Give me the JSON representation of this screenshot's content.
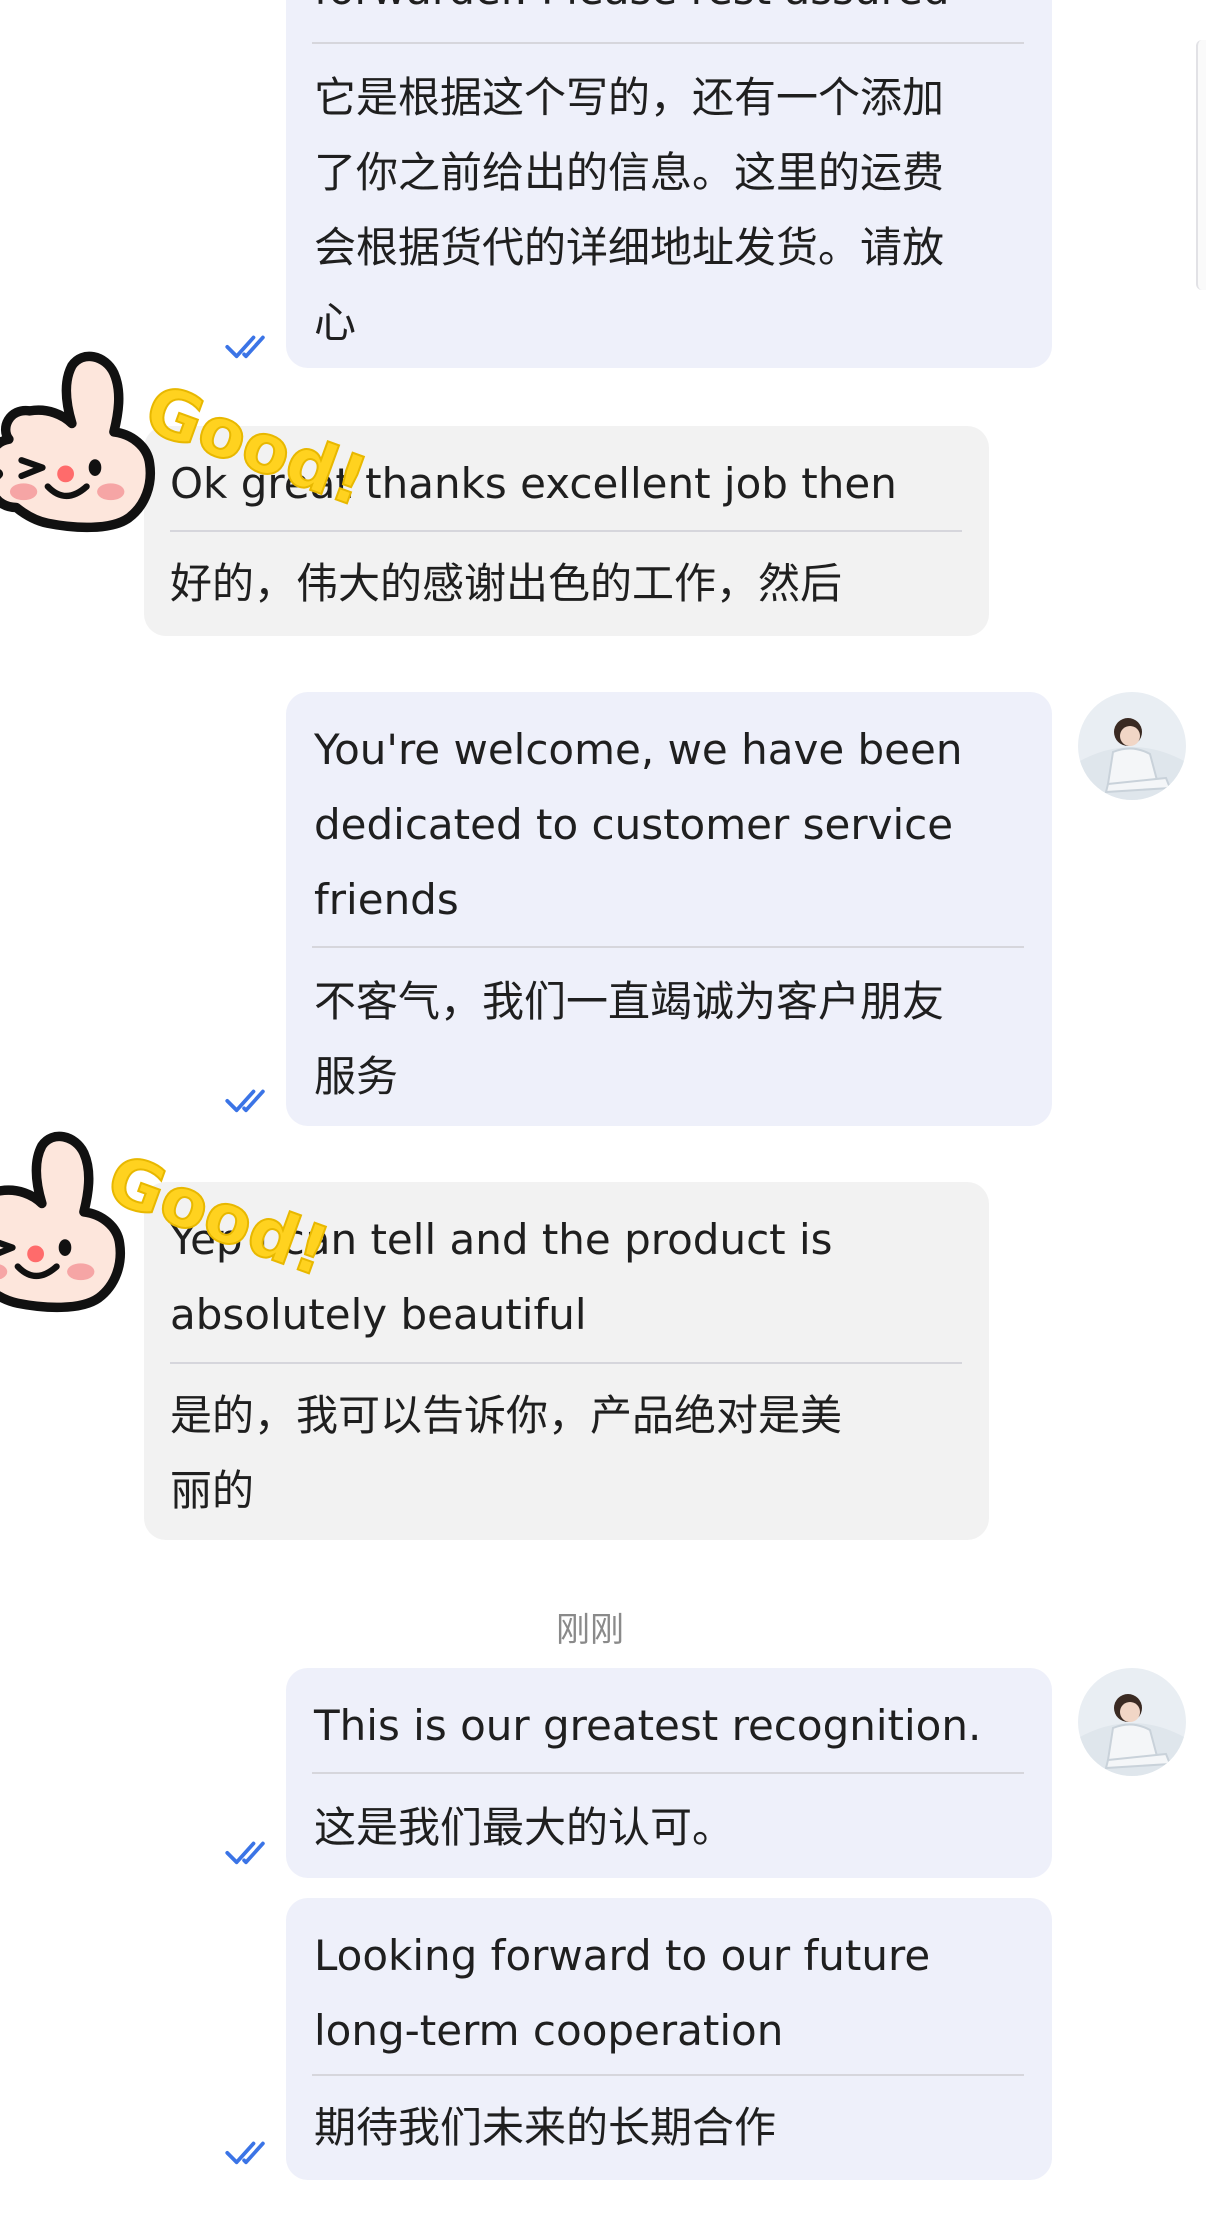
{
  "colors": {
    "outgoing_bubble": "#eef0fa",
    "incoming_bubble": "#f2f2f2",
    "read_check": "#3b74e6",
    "sticker_text": "#ffd21f"
  },
  "messages": [
    {
      "direction": "outgoing",
      "original": "forwarder. Please rest assured",
      "translation": [
        "它是根据这个写的，还有一个添加",
        "了你之前给出的信息。这里的运费",
        "会根据货代的详细地址发货。请放",
        "心"
      ]
    },
    {
      "direction": "incoming",
      "original": "Ok great thanks excellent job then",
      "translation": [
        "好的，伟大的感谢出色的工作，然后"
      ]
    },
    {
      "direction": "outgoing",
      "original": [
        "You're welcome, we have been",
        "dedicated to customer service",
        "friends"
      ],
      "translation": [
        "不客气，我们一直竭诚为客户朋友",
        "服务"
      ]
    },
    {
      "direction": "incoming",
      "original": [
        "Yep I can tell and the product is",
        "absolutely beautiful"
      ],
      "translation": [
        "是的，我可以告诉你，产品绝对是美",
        "丽的"
      ]
    },
    {
      "direction": "outgoing",
      "original": "This is our greatest recognition.",
      "translation": [
        "这是我们最大的认可。"
      ]
    },
    {
      "direction": "outgoing",
      "original": [
        "Looking forward to our future",
        "long-term cooperation"
      ],
      "translation": [
        "期待我们未来的长期合作"
      ]
    }
  ],
  "timestamp": "刚刚",
  "sticker": {
    "text": "Good!",
    "icon": "thumbs-up-icon"
  },
  "avatar": {
    "icon": "user-avatar-icon"
  },
  "read_status": {
    "icon": "double-check-icon"
  }
}
